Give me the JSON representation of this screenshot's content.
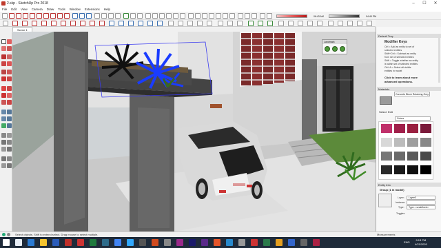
{
  "window": {
    "title": "2.skp - SketchUp Pro 2018",
    "controls": [
      "–",
      "☐",
      "✕"
    ]
  },
  "menu": [
    "File",
    "Edit",
    "View",
    "Camera",
    "Draw",
    "Tools",
    "Window",
    "Extensions",
    "Help"
  ],
  "shadow_settings": {
    "time_left": "06:43 AM",
    "time_right": "04:45 PM"
  },
  "scene_tab": "Scene 1",
  "floating_toolbar": {
    "title": "Landmark"
  },
  "tray": {
    "default_tray_header": "Default Tray",
    "instructor": {
      "title": "Modifier Keys",
      "lines": [
        "Ctrl = Add an entity to set of",
        "selected entities",
        "Shift+Ctrl = Subtract an entity",
        "from set of selected entities",
        "Shift = Toggle whether an entity",
        "is within set of selected entities",
        "Ctrl+A = Select all visible",
        "entities in model"
      ],
      "more": [
        "Click to learn about more",
        "advanced operations."
      ]
    },
    "materials": {
      "header": "Materials",
      "selected_name": "Concrete Block Retaining Grey",
      "tabs": [
        "Select",
        "Edit"
      ],
      "library": "Colors",
      "swatch_colors": [
        "#c0306a",
        "#a0204a",
        "#9a2040",
        "#7a1a3a",
        "#d8d8d8",
        "#bcbcbc",
        "#9e9e9e",
        "#888888",
        "#777777",
        "#6a6a6a",
        "#5a5a5a",
        "#4a4a4a",
        "#2a2a2a",
        "#1a1a1a",
        "#101010",
        "#000000"
      ]
    },
    "entity_info": {
      "header": "Entity Info",
      "title": "Group (1 in model)",
      "layer_label": "Layer:",
      "layer_value": "Layer0",
      "instance_label": "Instance:",
      "instance_value": "",
      "type_label": "Type:",
      "type_value": "Type: <undefined>",
      "toggles_label": "Toggles:"
    }
  },
  "status": {
    "message": "Select objects. Shift to extend select. Drag mouse to select multiple.",
    "measurements_label": "Measurements"
  },
  "taskbar": {
    "time": "9:13 PM",
    "date": "4/21/2020",
    "language": "ENG"
  }
}
